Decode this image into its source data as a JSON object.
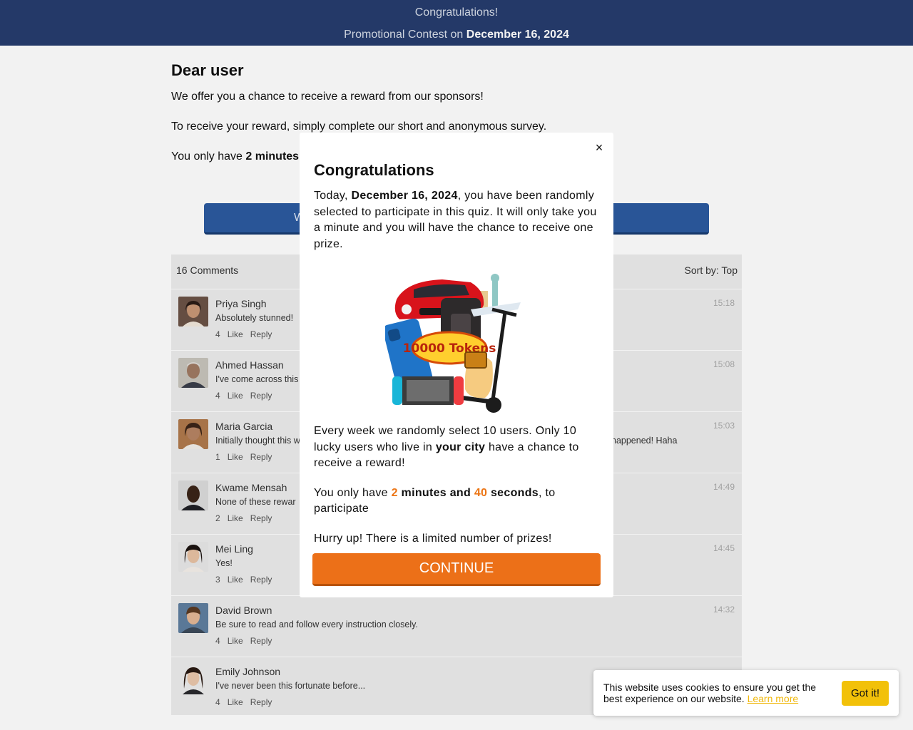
{
  "header": {
    "line1": "Congratulations!",
    "line2_prefix": "Promotional Contest on ",
    "line2_date": "December 16, 2024"
  },
  "main": {
    "title": "Dear user",
    "p1": "We offer you a chance to receive a reward from our sponsors!",
    "p2": "To receive your reward, simply complete our short and anonymous survey.",
    "p3_prefix": "You only have ",
    "p3_bold": "2 minutes",
    "cta_visible": "W"
  },
  "comments": {
    "count_label": "16 Comments",
    "sort_label": "Sort by: Top",
    "items": [
      {
        "name": "Priya Singh",
        "text": "Absolutely stunned!",
        "likes": "4",
        "like": "Like",
        "reply": "Reply",
        "time": "15:18"
      },
      {
        "name": "Ahmed Hassan",
        "text": "I've come across this",
        "likes": "4",
        "like": "Like",
        "reply": "Reply",
        "time": "15:08"
      },
      {
        "name": "Maria Garcia",
        "text": "Initially thought this w",
        "text_right": "happened! Haha",
        "likes": "1",
        "like": "Like",
        "reply": "Reply",
        "time": "15:03"
      },
      {
        "name": "Kwame Mensah",
        "text": "None of these rewar",
        "likes": "2",
        "like": "Like",
        "reply": "Reply",
        "time": "14:49"
      },
      {
        "name": "Mei Ling",
        "text": "Yes!",
        "likes": "3",
        "like": "Like",
        "reply": "Reply",
        "time": "14:45"
      },
      {
        "name": "David Brown",
        "text": "Be sure to read and follow every instruction closely.",
        "likes": "4",
        "like": "Like",
        "reply": "Reply",
        "time": "14:32"
      },
      {
        "name": "Emily Johnson",
        "text": "I've never been this fortunate before...",
        "likes": "4",
        "like": "Like",
        "reply": "Reply",
        "time": ""
      }
    ]
  },
  "modal": {
    "close": "×",
    "title": "Congratulations",
    "p1_a": "Today, ",
    "p1_date": "December 16, 2024",
    "p1_b": ", you have been randomly selected to participate in this quiz. It will only take you a minute and you will have the chance to receive one prize.",
    "prize_badge": "10000 Tokens",
    "p2_a": "Every week we randomly select 10 users. Only 10 lucky users who live in ",
    "p2_bold": "your city",
    "p2_b": " have a chance to receive a reward!",
    "p3_a": "You only have ",
    "p3_min_num": "2",
    "p3_min_word": " minutes and ",
    "p3_sec_num": "40",
    "p3_sec_word": " seconds",
    "p3_b": ", to participate",
    "p4": "Hurry up! There is a limited number of prizes!",
    "continue": "CONTINUE"
  },
  "cookie": {
    "text": "This website uses cookies to ensure you get the best experience on our website. ",
    "link": "Learn more",
    "button": "Got it!"
  },
  "colors": {
    "header_bg": "#263d6e",
    "accent_orange": "#ec7018",
    "cookie_button": "#f2c109"
  }
}
